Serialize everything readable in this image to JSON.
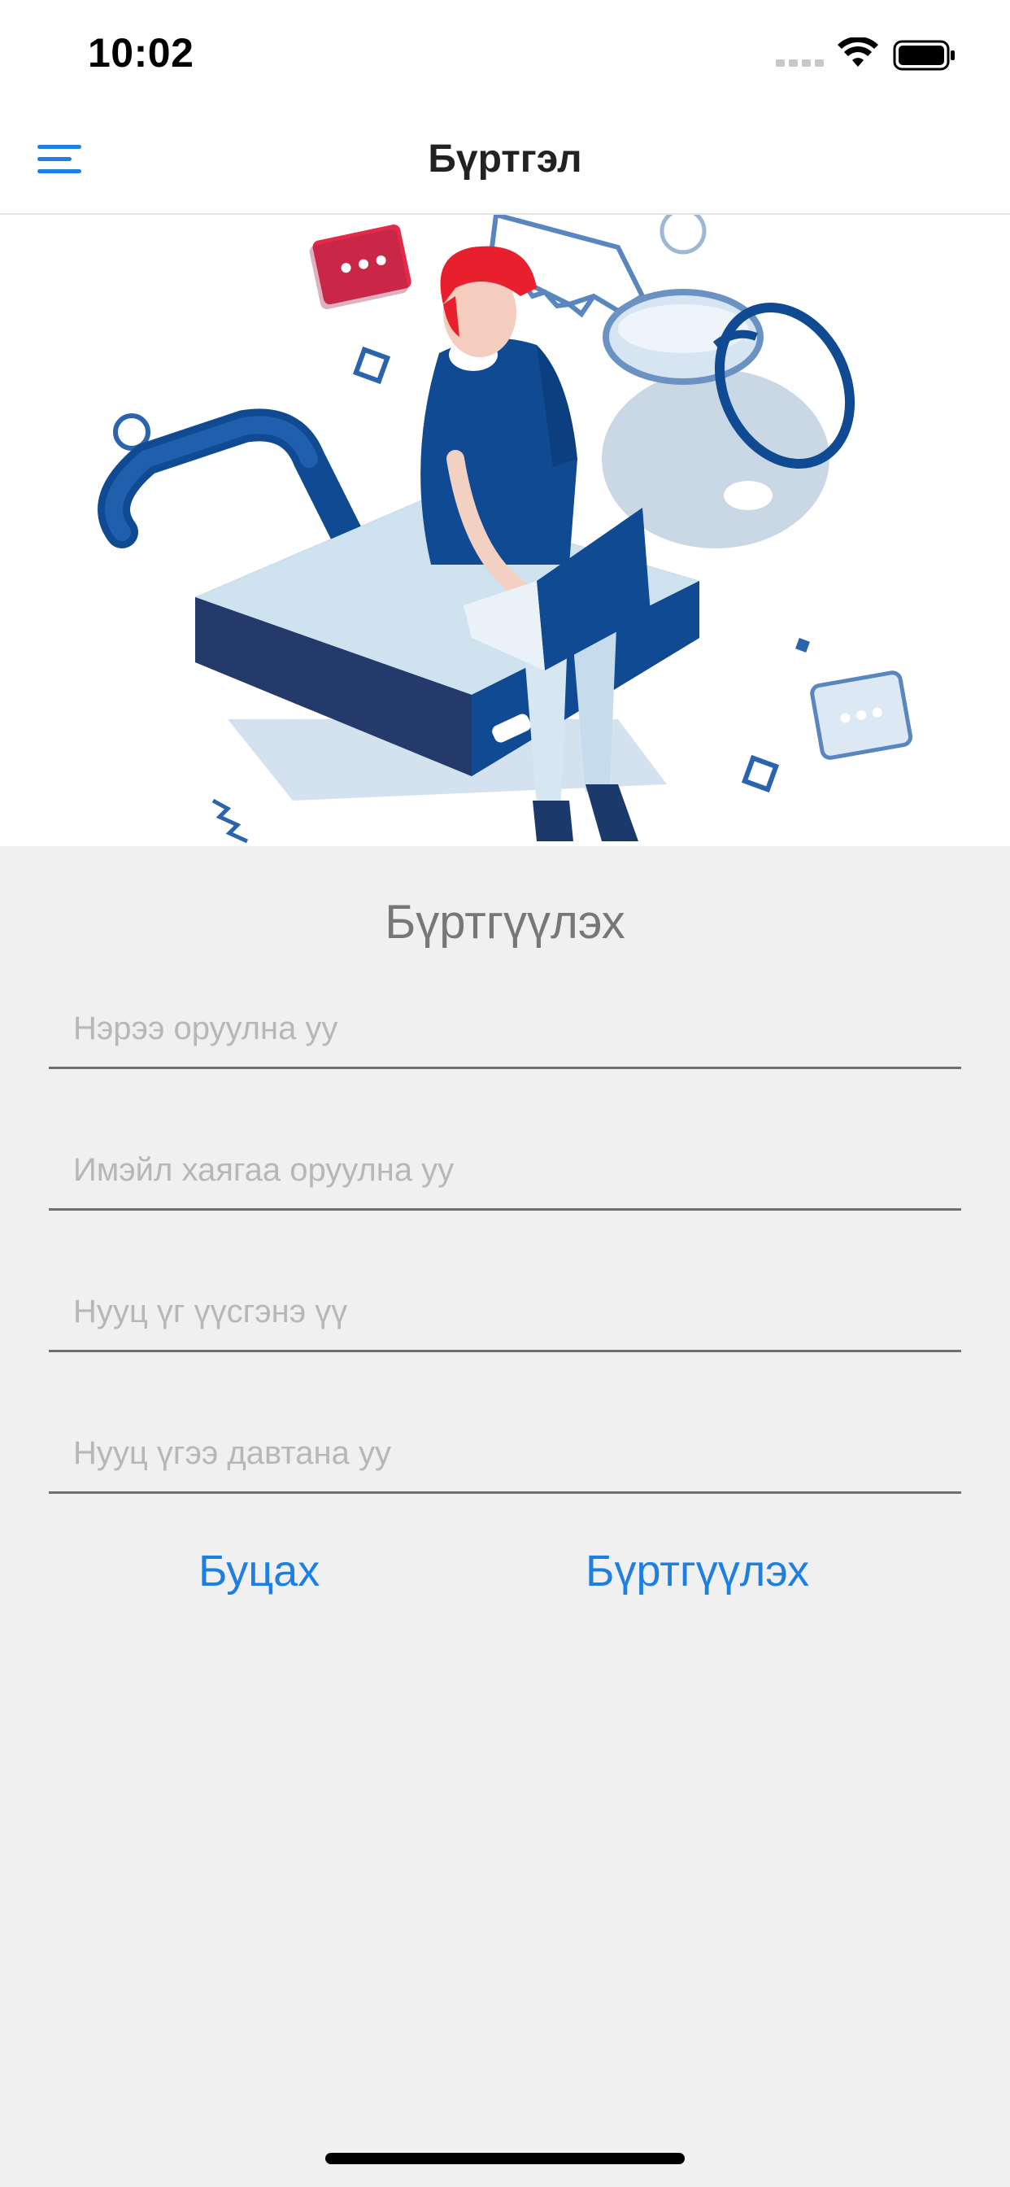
{
  "status_bar": {
    "time": "10:02"
  },
  "nav": {
    "title": "Бүртгэл"
  },
  "form": {
    "heading": "Бүртгүүлэх",
    "name_placeholder": "Нэрээ оруулна уу",
    "email_placeholder": "Имэйл хаягаа оруулна уу",
    "password_placeholder": "Нууц үг үүсгэнэ үү",
    "confirm_placeholder": "Нууц үгээ давтана уу"
  },
  "buttons": {
    "back_label": "Буцах",
    "register_label": "Бүртгүүлэх"
  },
  "colors": {
    "accent": "#1e7fe3",
    "background": "#f0f0f0"
  }
}
